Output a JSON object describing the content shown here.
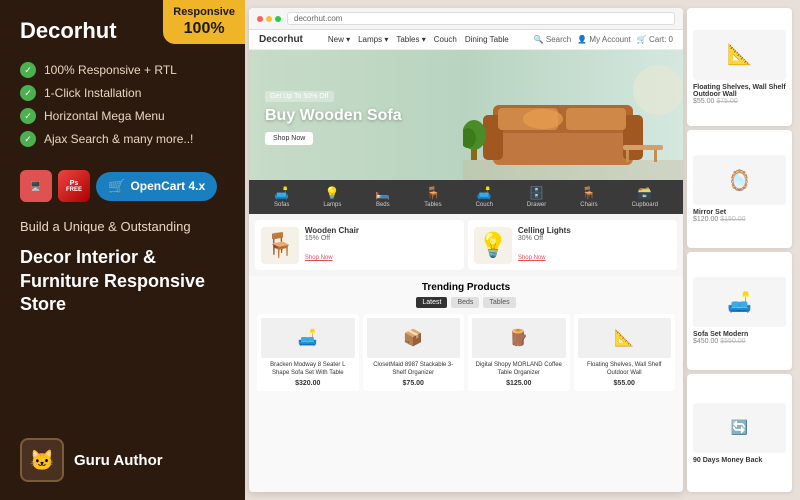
{
  "sidebar": {
    "title": "Decorhut",
    "features": [
      "100% Responsive + RTL",
      "1-Click Installation",
      "Horizontal Mega Menu",
      "Ajax Search & many more..!"
    ],
    "badge_opencart": "OpenCart 4.x",
    "badge_ps_label": "FREE",
    "description": "Build a Unique & Outstanding",
    "store_title": "Decor Interior & Furniture Responsive Store",
    "author_name": "Guru Author"
  },
  "responsive_badge": {
    "label": "Responsive",
    "percent": "100%"
  },
  "store": {
    "logo": "Decorhut",
    "nav_items": [
      "New ▾",
      "Lamps ▾",
      "Tables ▾",
      "Couch",
      "Dining Table"
    ],
    "nav_actions": [
      "🔍 Search",
      "👤 My Account",
      "🛒 Cart: 0"
    ],
    "hero_tag": "Get Up To 50% Off",
    "hero_title": "Buy Wooden Sofa",
    "hero_btn": "Shop Now",
    "category_items": [
      {
        "label": "Sofas",
        "icon": "🛋️"
      },
      {
        "label": "Lamps",
        "icon": "💡"
      },
      {
        "label": "Beds",
        "icon": "🛏️"
      },
      {
        "label": "Tables",
        "icon": "🪑"
      },
      {
        "label": "Couch",
        "icon": "🛋️"
      },
      {
        "label": "Drawer",
        "icon": "🗄️"
      },
      {
        "label": "Chairs",
        "icon": "🪑"
      },
      {
        "label": "Cupboard",
        "icon": "🗃️"
      }
    ],
    "promo": [
      {
        "title": "Wooden Chair",
        "discount": "15% Off",
        "link": "Shop Now"
      },
      {
        "title": "Celling Lights",
        "discount": "30% Off",
        "link": "Shop Now"
      }
    ],
    "trending_title": "Trending Products",
    "filter_tabs": [
      "Latest",
      "Beds",
      "Tables"
    ],
    "products": [
      {
        "name": "Bracken Modway 8 Seater L Shape Sofa Set With Table",
        "price": "$320.00",
        "icon": "🛋️"
      },
      {
        "name": "ClosetMaid 8987 Stackable 3-Shelf Organizer",
        "price": "$75.00",
        "icon": "📦"
      },
      {
        "name": "Digital Shopy MORLAND Coffee Table Organizer",
        "price": "$125.00",
        "icon": "🪵"
      },
      {
        "name": "Floating Shelves, Wall Shelf Outdoor Wall",
        "price": "$55.00",
        "icon": "📐"
      }
    ]
  },
  "side_panel": [
    {
      "title": "Floating Shelves, Wall Shelf Outdoor Wall",
      "price": "$55.00",
      "old_price": "$75.00",
      "icon": "📐"
    },
    {
      "title": "Mirror Set",
      "price": "$120.00",
      "old_price": "$150.00",
      "icon": "🪞"
    },
    {
      "title": "Sofa Set Modern",
      "price": "$450.00",
      "old_price": "$550.00",
      "icon": "🛋️"
    },
    {
      "title": "90 Days Money Back",
      "price": "",
      "old_price": "",
      "icon": "🔄"
    }
  ]
}
